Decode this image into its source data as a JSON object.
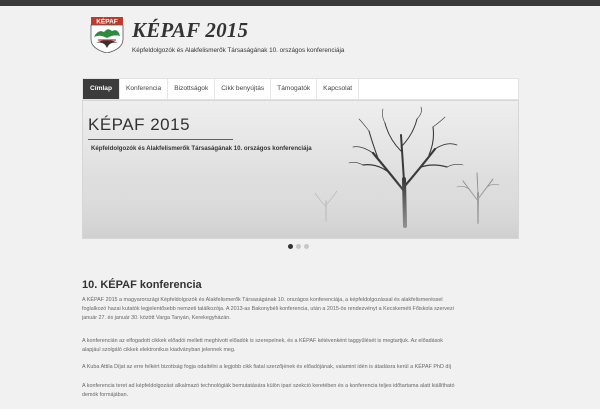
{
  "header": {
    "logo_text": "KÉPAF",
    "title": "KÉPAF 2015",
    "subtitle": "Képfeldolgozók és Alakfelismerők Társaságának 10. országos konferenciája"
  },
  "nav": {
    "items": [
      "Címlap",
      "Konferencia",
      "Bizottságok",
      "Cikk benyújtás",
      "Támogatók",
      "Kapcsolat"
    ],
    "active_index": 0
  },
  "slider": {
    "title": "KÉPAF 2015",
    "subtitle": "Képfeldolgozók és Alakfelismerők Társaságának 10. országos konferenciája",
    "slide_count": 3,
    "active_slide": 1
  },
  "content": {
    "heading": "10. KÉPAF konferencia",
    "paragraphs": [
      [
        "A KÉPAF 2015 a magyarországi Képfeldolgozók és Alakfelismerők Társaságának 10. országos konferenciája, a képfeldolgozással és alakfelismeréssel",
        "foglalkozó hazai kutatók legjelentősebb nemzeti találkozója. A 2013-as Bakonybéli konferencia, után a 2015-ös rendezvényt a Kecskeméti Főiskola szervezi",
        "január 27. és január 30. között Varga Tanyán, Kerekegyházán."
      ],
      [
        "A konferencián az elfogadott cikkek előadói mellett meghívott előadók is szerepelnek, és a KÉPAF kétévenként taggyűlését is megtartjuk. Az előadások",
        "alapjául szolgáló cikkek elektronikus kiadványban jelennek meg."
      ],
      [
        "A Kuba Attila Díjat az erre felkért bizottság fogja odaítélni a legjobb cikk fiatal szerzőjének és előadójának, valamint idén is átadásra kerül a KÉPAF PhD díj"
      ],
      [
        "A konferencia teret ad képfeldolgozást alkalmazó technológiák bemutatására külön ipari szekció keretében és a konferencia teljes időtartama alatt kiállítható",
        "demók formájában."
      ]
    ]
  },
  "colors": {
    "topbar": "#3a3a3a",
    "nav_active": "#3b3b3b",
    "accent_rule": "#c0392b",
    "logo_red": "#c0392b",
    "logo_green": "#2e8b3e"
  },
  "icons": [
    "kepaf-logo-emblem"
  ]
}
